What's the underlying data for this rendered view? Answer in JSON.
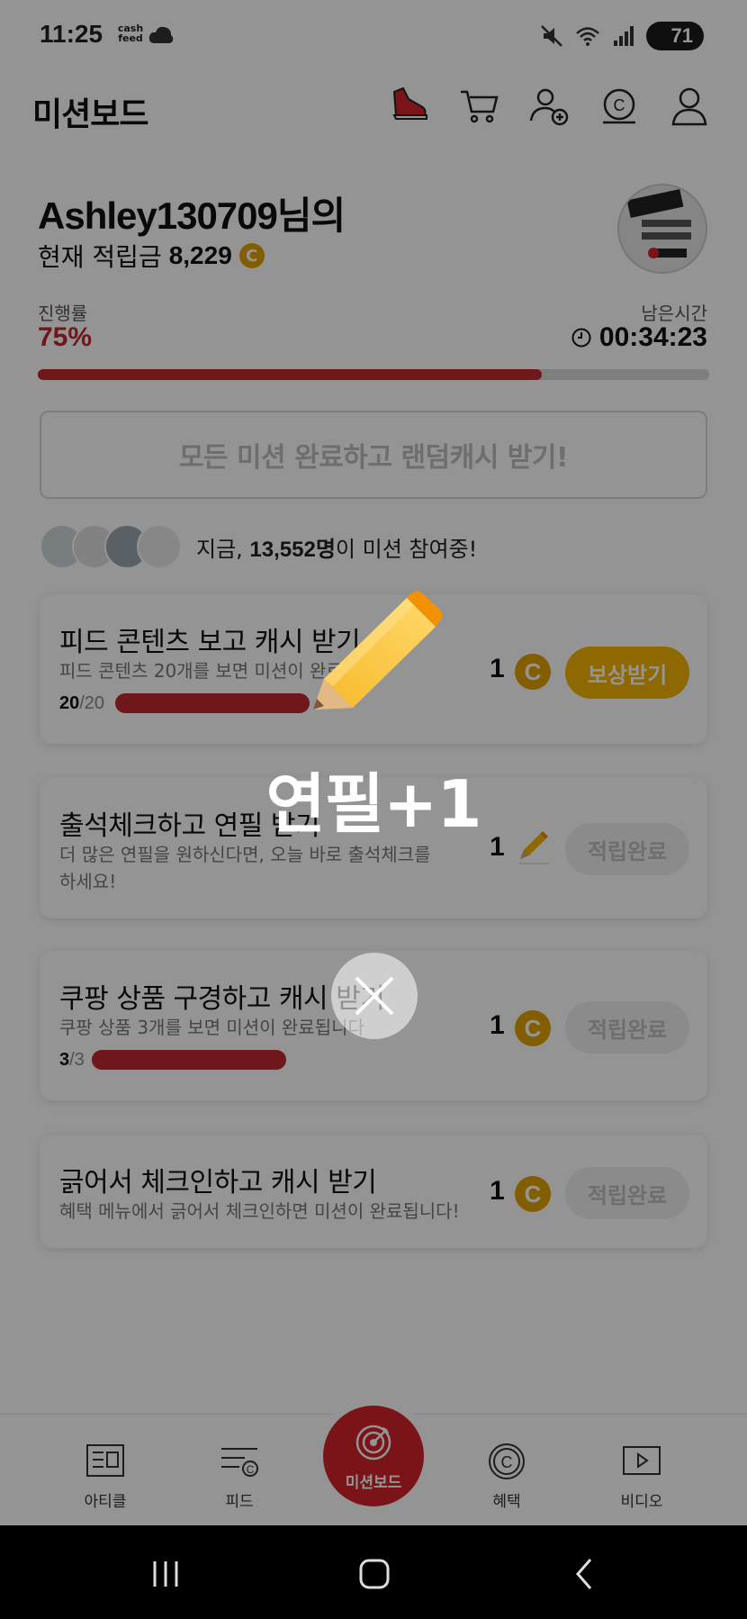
{
  "status_bar": {
    "time": "11:25",
    "app_badge": "cash feed",
    "battery": "71"
  },
  "header": {
    "title": "미션보드",
    "icons": [
      "sneaker-icon",
      "cart-icon",
      "add-friend-icon",
      "cash-icon",
      "profile-icon"
    ]
  },
  "profile": {
    "username": "Ashley130709님의",
    "points_label": "현재 적립금",
    "points_value": "8,229",
    "coin_symbol": "C"
  },
  "progress": {
    "label": "진행률",
    "value": "75%",
    "fraction": 0.75,
    "remaining_label": "남은시간",
    "remaining_value": "00:34:23"
  },
  "all_mission_button": "모든 미션 완료하고 랜덤캐시 받기!",
  "participants": {
    "prefix": "지금, ",
    "count": "13,552명",
    "suffix": "이 미션 참여중!"
  },
  "missions": [
    {
      "title": "피드 콘텐츠 보고 캐시 받기",
      "desc": "피드 콘텐츠 20개를 보면 미션이 완료",
      "count_done": "20",
      "count_total": "/20",
      "fraction": 1.0,
      "reward": "1",
      "reward_type": "coin",
      "button": "보상받기"
    },
    {
      "title": "출석체크하고 연필 받기",
      "desc": "더 많은 연필을 원하신다면, 오늘 바로 출석체크를 하세요!",
      "reward": "1",
      "reward_type": "pencil",
      "button": "적립완료"
    },
    {
      "title": "쿠팡 상품 구경하고 캐시 받기",
      "desc": "쿠팡 상품 3개를 보면 미션이 완료됩니다",
      "count_done": "3",
      "count_total": "/3",
      "fraction": 1.0,
      "reward": "1",
      "reward_type": "coin",
      "button": "적립완료"
    },
    {
      "title": "긁어서 체크인하고 캐시 받기",
      "desc": "혜택 메뉴에서 긁어서 체크인하면 미션이 완료됩니다!",
      "reward": "1",
      "reward_type": "coin",
      "button": "적립완료"
    }
  ],
  "bottom_nav": [
    {
      "label": "아티클",
      "icon": "article-icon"
    },
    {
      "label": "피드",
      "icon": "feed-icon"
    },
    {
      "label": "미션보드",
      "icon": "target-icon"
    },
    {
      "label": "혜택",
      "icon": "benefit-icon"
    },
    {
      "label": "비디오",
      "icon": "video-icon"
    }
  ],
  "popup": {
    "text": "연필+1",
    "icon": "pencil-icon",
    "close_icon": "close-icon"
  },
  "colors": {
    "accent_red": "#c0282d",
    "coin_gold": "#e2a300",
    "claim_yellow": "#f5b400"
  }
}
